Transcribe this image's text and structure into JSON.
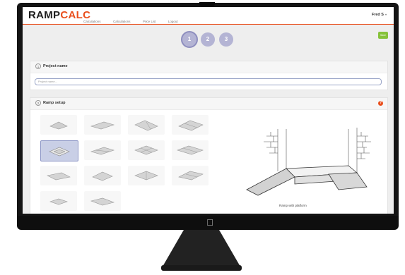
{
  "app": {
    "logo_part1": "RAMP",
    "logo_part2": "CALC",
    "nav": [
      "Calculations",
      "Calculations",
      "Price List",
      "Logout"
    ],
    "user": "Fred S"
  },
  "stepper": {
    "steps": [
      "1",
      "2",
      "3"
    ],
    "active_step": 1,
    "save_label": "Save"
  },
  "project": {
    "number": "1",
    "title": "Project name",
    "input_placeholder": "Project name..."
  },
  "setup": {
    "number": "2",
    "title": "Ramp setup",
    "help_symbol": "?",
    "selected_index": 4,
    "preview_caption": "Ramp with platform"
  },
  "colors": {
    "accent": "#e94f1d",
    "step": "#b4b4d4",
    "save": "#86c23a",
    "selection": "#c9cfe6"
  },
  "icons": {
    "apple": "apple-logo-icon",
    "help": "question-icon",
    "ramp_tiles": "ramp-thumbnail-icon"
  }
}
